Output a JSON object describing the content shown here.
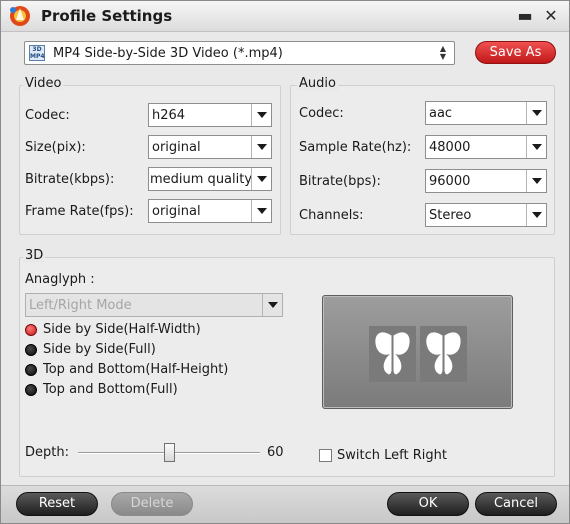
{
  "window": {
    "title": "Profile Settings",
    "minimize_glyph": "▬",
    "close_glyph": "✕",
    "logo_icon": "app-logo-icon"
  },
  "profile": {
    "selected": "MP4 Side-by-Side 3D Video (*.mp4)",
    "icon": "3d-mp4-icon",
    "icon_text_top": "3D",
    "icon_text_bottom": "MP4",
    "save_as_label": "Save As"
  },
  "video": {
    "group_title": "Video",
    "codec_label": "Codec:",
    "codec_value": "h264",
    "size_label": "Size(pix):",
    "size_value": "original",
    "bitrate_label": "Bitrate(kbps):",
    "bitrate_value": "medium quality",
    "framerate_label": "Frame Rate(fps):",
    "framerate_value": "original"
  },
  "audio": {
    "group_title": "Audio",
    "codec_label": "Codec:",
    "codec_value": "aac",
    "samplerate_label": "Sample Rate(hz):",
    "samplerate_value": "48000",
    "bitrate_label": "Bitrate(bps):",
    "bitrate_value": "96000",
    "channels_label": "Channels:",
    "channels_value": "Stereo"
  },
  "three_d": {
    "group_title": "3D",
    "anaglyph_label": "Anaglyph :",
    "anaglyph_value": "Left/Right Mode",
    "modes": [
      {
        "label": "Side by Side(Half-Width)",
        "checked": true
      },
      {
        "label": "Side by Side(Full)",
        "checked": false
      },
      {
        "label": "Top and Bottom(Half-Height)",
        "checked": false
      },
      {
        "label": "Top and Bottom(Full)",
        "checked": false
      }
    ],
    "depth_label": "Depth:",
    "depth_value": "60",
    "switch_label": "Switch Left Right",
    "switch_checked": false,
    "preview_icon": "butterfly-preview-icon"
  },
  "footer": {
    "reset_label": "Reset",
    "delete_label": "Delete",
    "ok_label": "OK",
    "cancel_label": "Cancel"
  },
  "colors": {
    "accent_red": "#d42222",
    "button_dark": "#2b2b2b"
  }
}
